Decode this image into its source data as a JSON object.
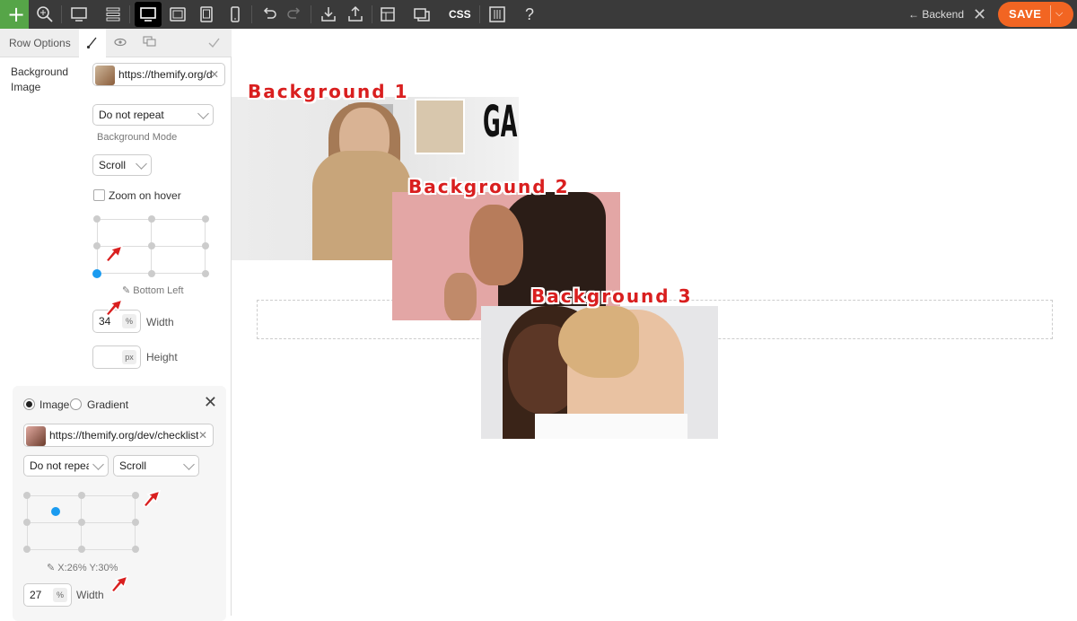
{
  "toolbar": {
    "add_icon": "plus-icon",
    "css_label": "CSS",
    "help_label": "?",
    "backend_label": "← Backend",
    "close_label": "✕",
    "save_label": "SAVE",
    "save_dropdown": "⌵"
  },
  "panel": {
    "title": "Row Options",
    "tabs": [
      "brush-icon",
      "eye-icon",
      "responsive-icon",
      "check-icon"
    ],
    "background_image_label": "Background Image",
    "image_url": "https://themify.org/d",
    "repeat_select": "Do not repeat",
    "background_mode_label": "Background Mode",
    "attachment_select": "Scroll",
    "zoom_label": "Zoom on hover",
    "position_label": "Bottom Left",
    "width_value": "34",
    "width_unit": "%",
    "width_label": "Width",
    "height_value": "",
    "height_unit": "px",
    "height_label": "Height"
  },
  "card": {
    "radio_image": "Image",
    "radio_gradient": "Gradient",
    "close": "✕",
    "image_url": "https://themify.org/dev/checklist/v",
    "repeat_select": "Do not repea",
    "attachment_select": "Scroll",
    "position_label": "X:26% Y:30%",
    "width_value": "27",
    "width_unit": "%",
    "width_label": "Width"
  },
  "canvas": {
    "bg1": "Background 1",
    "bg2": "Background 2",
    "bg3": "Background 3"
  },
  "colors": {
    "accent": "#f26522",
    "selected_dot": "#1a9bf0",
    "annotation": "#d91f1f"
  }
}
